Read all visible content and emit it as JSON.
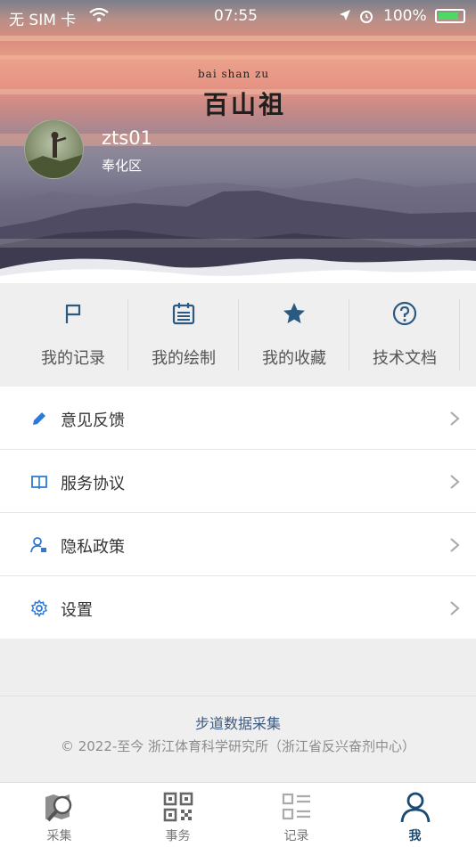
{
  "status_bar": {
    "carrier": "无 SIM 卡",
    "time": "07:55",
    "battery_pct": "100%"
  },
  "banner": {
    "logo_sub": "bai shan zu",
    "logo_main": "百山祖"
  },
  "profile": {
    "username": "zts01",
    "district": "奉化区"
  },
  "quick_actions": [
    {
      "label": "我的记录",
      "icon": "flag-icon"
    },
    {
      "label": "我的绘制",
      "icon": "calendar-icon"
    },
    {
      "label": "我的收藏",
      "icon": "star-icon"
    },
    {
      "label": "技术文档",
      "icon": "help-icon"
    }
  ],
  "menu": [
    {
      "label": "意见反馈",
      "icon": "pencil-icon"
    },
    {
      "label": "服务协议",
      "icon": "book-icon"
    },
    {
      "label": "隐私政策",
      "icon": "user-shield-icon"
    },
    {
      "label": "设置",
      "icon": "gear-icon"
    }
  ],
  "footer": {
    "title": "步道数据采集",
    "copyright": "© 2022-至今 浙江体育科学研究所（浙江省反兴奋剂中心）"
  },
  "tabs": [
    {
      "label": "采集",
      "icon": "map-search-icon",
      "active": false
    },
    {
      "label": "事务",
      "icon": "qr-icon",
      "active": false
    },
    {
      "label": "记录",
      "icon": "list-icon",
      "active": false
    },
    {
      "label": "我",
      "icon": "person-icon",
      "active": true
    }
  ],
  "colors": {
    "accent": "#1a4a72",
    "icon_blue": "#2a7ad6",
    "quick_icon": "#2a5a82"
  }
}
